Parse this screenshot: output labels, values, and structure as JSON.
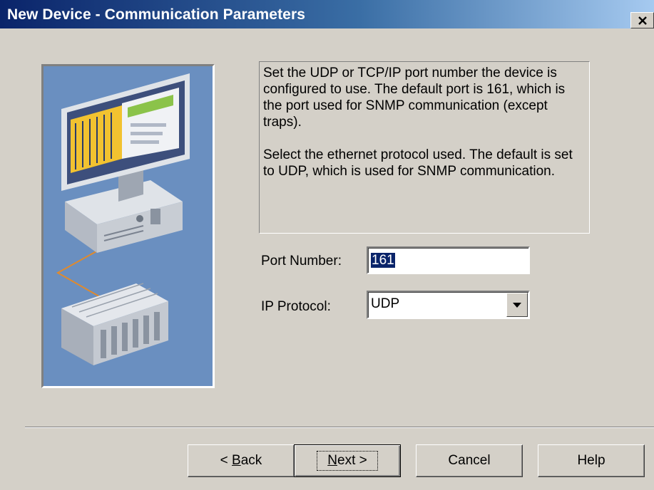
{
  "window": {
    "title": "New Device - Communication Parameters",
    "close_label": "×"
  },
  "description": {
    "paragraph1": "Set the UDP or TCP/IP port number the device is configured to use. The default port is 161, which is the port used for SNMP communication (except traps).",
    "paragraph2": "Select the ethernet protocol used. The default is set to UDP, which is used for SNMP communication."
  },
  "form": {
    "port_label": "Port Number:",
    "port_value": "161",
    "protocol_label": "IP Protocol:",
    "protocol_value": "UDP"
  },
  "buttons": {
    "back_prefix": "< ",
    "back_accel": "B",
    "back_rest": "ack",
    "next_accel": "N",
    "next_rest": "ext >",
    "cancel": "Cancel",
    "help": "Help"
  },
  "illustration": {
    "name": "computer-and-device-illustration",
    "background_color": "#6a8fc0"
  }
}
